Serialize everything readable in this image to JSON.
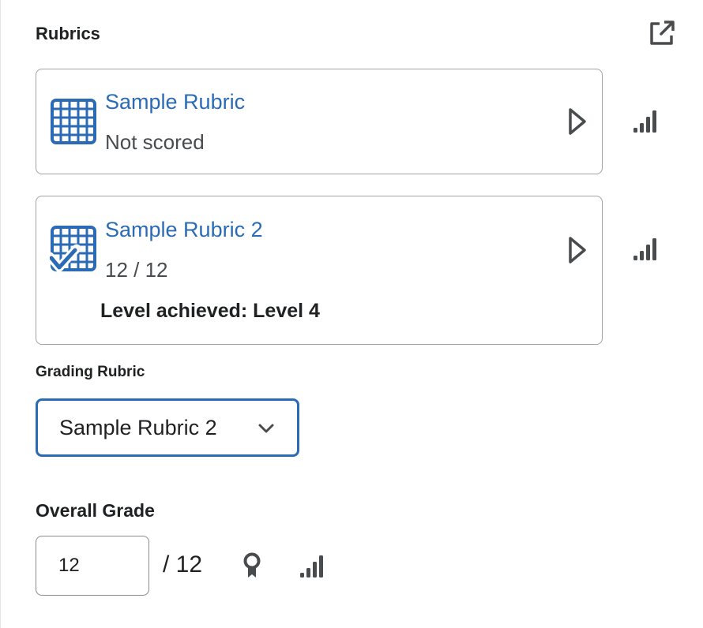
{
  "panel": {
    "title": "Rubrics",
    "popout_icon": "popout-icon"
  },
  "rubrics": [
    {
      "name": "Sample Rubric",
      "status": "Not scored",
      "icon": "rubric-grid-icon"
    },
    {
      "name": "Sample Rubric 2",
      "status": "12 / 12",
      "level_label": "Level achieved: Level 4",
      "icon": "rubric-grid-check-icon"
    }
  ],
  "grading_rubric": {
    "label": "Grading Rubric",
    "selected": "Sample Rubric 2"
  },
  "overall_grade": {
    "label": "Overall Grade",
    "value": "12",
    "total": "/ 12"
  },
  "colors": {
    "accent": "#2b6bb5",
    "text": "#202122",
    "border": "#a0a3a8"
  }
}
